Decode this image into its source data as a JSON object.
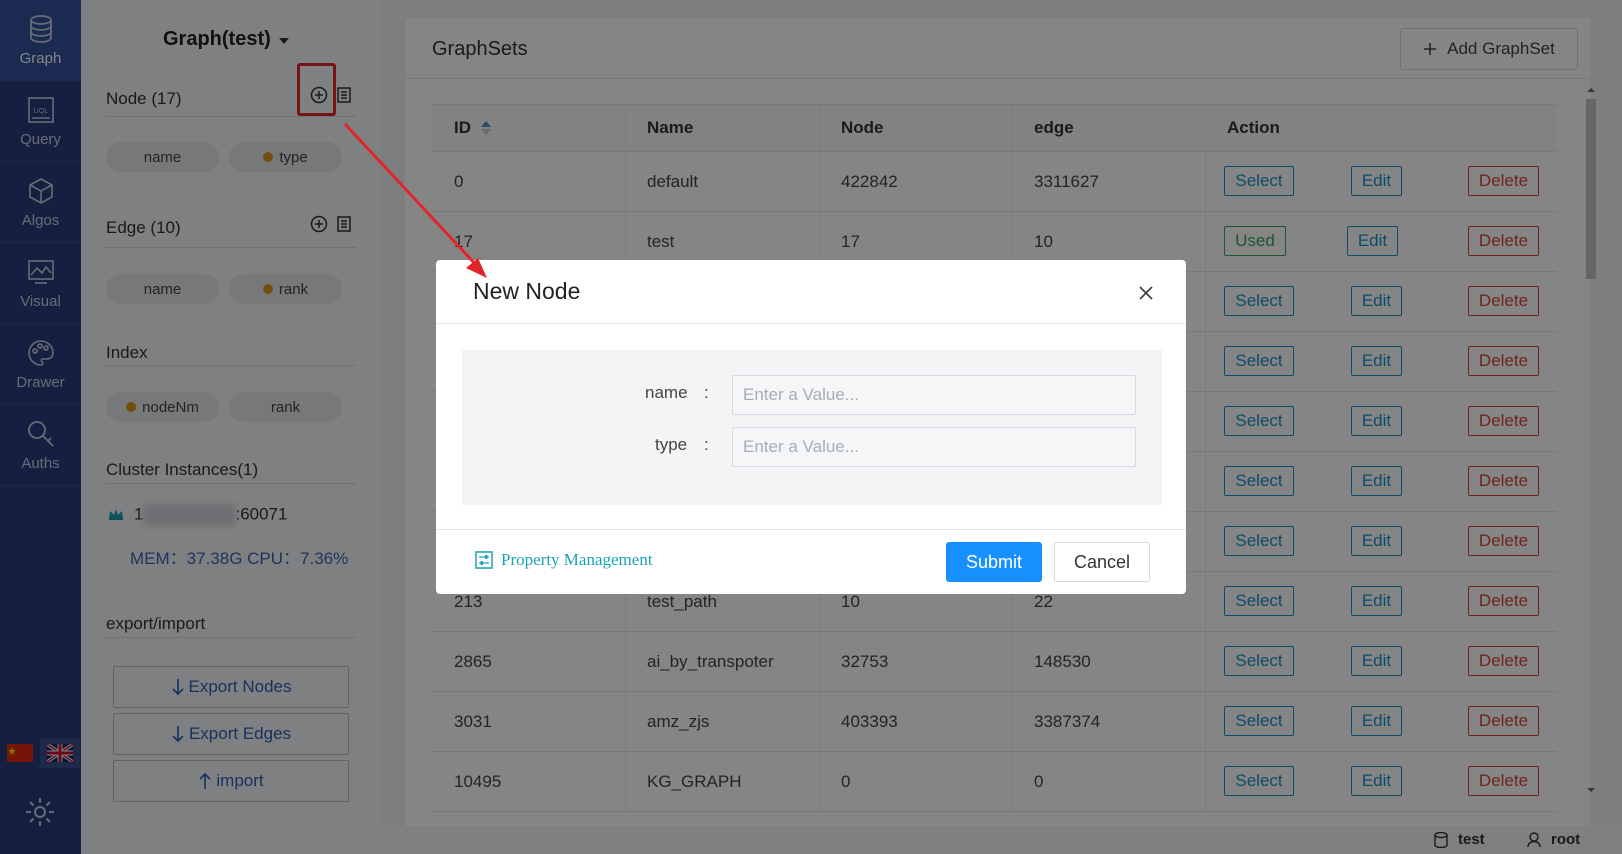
{
  "nav": {
    "items": [
      {
        "label": "Graph",
        "icon": "database-icon"
      },
      {
        "label": "Query",
        "icon": "uql-icon"
      },
      {
        "label": "Algos",
        "icon": "cube-icon"
      },
      {
        "label": "Visual",
        "icon": "chart-icon"
      },
      {
        "label": "Drawer",
        "icon": "palette-icon"
      },
      {
        "label": "Auths",
        "icon": "key-search-icon"
      }
    ],
    "active": "Graph"
  },
  "panel": {
    "graph_selector": "Graph(test)",
    "node_section": {
      "title": "Node (17)",
      "pills": [
        "name",
        "type"
      ]
    },
    "edge_section": {
      "title": "Edge (10)",
      "pills": [
        "name",
        "rank"
      ]
    },
    "index_section": {
      "title": "Index",
      "pills": [
        "nodeNm",
        "rank"
      ]
    },
    "cluster": {
      "title": "Cluster Instances(1)",
      "instance_prefix": "1",
      "instance_port": ":60071",
      "mem_cpu": "MEM：37.38G CPU：7.36%"
    },
    "export_section": {
      "title": "export/import",
      "export_nodes": "Export Nodes",
      "export_edges": "Export Edges",
      "import": "import"
    }
  },
  "main": {
    "title": "GraphSets",
    "add_button": "Add GraphSet",
    "columns": [
      "ID",
      "Name",
      "Node",
      "edge",
      "Action"
    ],
    "action_labels": {
      "select": "Select",
      "used": "Used",
      "edit": "Edit",
      "delete": "Delete"
    },
    "rows": [
      {
        "id": "0",
        "name": "default",
        "node": "422842",
        "edge": "3311627",
        "used": false
      },
      {
        "id": "17",
        "name": "test",
        "node": "17",
        "edge": "10",
        "used": true
      },
      {
        "id": "",
        "name": "",
        "node": "",
        "edge": "",
        "used": false
      },
      {
        "id": "",
        "name": "",
        "node": "",
        "edge": "",
        "used": false
      },
      {
        "id": "",
        "name": "",
        "node": "",
        "edge": "",
        "used": false
      },
      {
        "id": "",
        "name": "",
        "node": "",
        "edge": "",
        "used": false
      },
      {
        "id": "",
        "name": "",
        "node": "",
        "edge": "",
        "used": false
      },
      {
        "id": "213",
        "name": "test_path",
        "node": "10",
        "edge": "22",
        "used": false
      },
      {
        "id": "2865",
        "name": "ai_by_transpoter",
        "node": "32753",
        "edge": "148530",
        "used": false
      },
      {
        "id": "3031",
        "name": "amz_zjs",
        "node": "403393",
        "edge": "3387374",
        "used": false
      },
      {
        "id": "10495",
        "name": "KG_GRAPH",
        "node": "0",
        "edge": "0",
        "used": false
      }
    ]
  },
  "status_bar": {
    "graph": "test",
    "user": "root"
  },
  "modal": {
    "title": "New Node",
    "fields": [
      {
        "label": "name",
        "placeholder": "Enter a Value..."
      },
      {
        "label": "type",
        "placeholder": "Enter a Value..."
      }
    ],
    "separator": ":",
    "property_link": "Property Management",
    "submit": "Submit",
    "cancel": "Cancel"
  },
  "colors": {
    "nav_bg": "#2a3f7c",
    "primary": "#1890ff",
    "select": "#1790c9",
    "used": "#3aa55d",
    "delete": "#d64339",
    "annotation": "#e0262a"
  }
}
